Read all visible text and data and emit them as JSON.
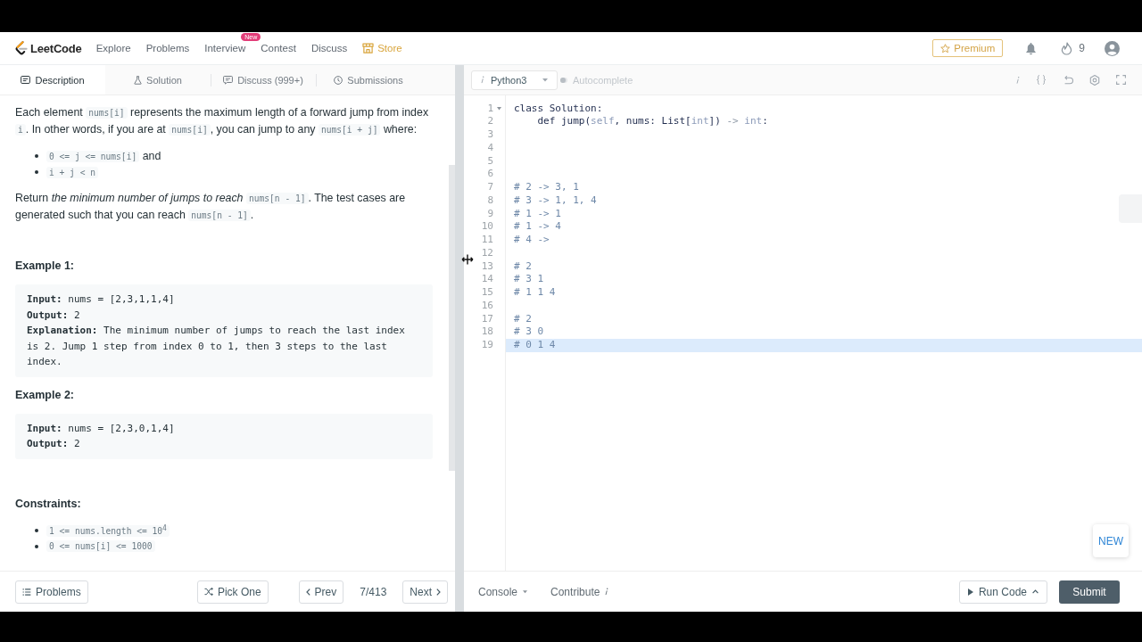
{
  "nav": {
    "logo": "LeetCode",
    "links": [
      {
        "label": "Explore",
        "kind": "link"
      },
      {
        "label": "Problems",
        "kind": "link"
      },
      {
        "label": "Interview",
        "kind": "link",
        "badge": "New"
      },
      {
        "label": "Contest",
        "kind": "link"
      },
      {
        "label": "Discuss",
        "kind": "link"
      },
      {
        "label": "Store",
        "kind": "store"
      }
    ],
    "premium": "Premium",
    "streak": "9"
  },
  "description_tabs": [
    {
      "label": "Description",
      "selected": true
    },
    {
      "label": "Solution",
      "selected": false
    },
    {
      "label": "Discuss (999+)",
      "selected": false
    },
    {
      "label": "Submissions",
      "selected": false
    }
  ],
  "description": {
    "intro": [
      {
        "kind": "paragraph",
        "segments": [
          {
            "kind": "text",
            "text": "Each element "
          },
          {
            "kind": "code",
            "text": "nums[i]"
          },
          {
            "kind": "text",
            "text": " represents the maximum length of a forward jump from index "
          },
          {
            "kind": "code",
            "text": "i"
          },
          {
            "kind": "text",
            "text": ". In other words, if you are at "
          },
          {
            "kind": "code",
            "text": "nums[i]"
          },
          {
            "kind": "text",
            "text": ", you can jump to any "
          },
          {
            "kind": "code",
            "text": "nums[i + j]"
          },
          {
            "kind": "text",
            "text": " where:"
          }
        ]
      },
      {
        "kind": "list",
        "items": [
          [
            {
              "kind": "code",
              "text": "0 <= j <= nums[i]"
            },
            {
              "kind": "text",
              "text": " and"
            }
          ],
          [
            {
              "kind": "code",
              "text": "i + j < n"
            }
          ]
        ]
      },
      {
        "kind": "paragraph",
        "segments": [
          {
            "kind": "text",
            "text": "Return *the minimum number of jumps to reach* "
          },
          {
            "kind": "code",
            "text": "nums[n - 1]"
          },
          {
            "kind": "text",
            "text": ". The test cases are generated such that you can reach "
          },
          {
            "kind": "code",
            "text": "nums[n - 1]"
          },
          {
            "kind": "text",
            "text": "."
          }
        ]
      }
    ],
    "examples": [
      {
        "title": "Example 1:",
        "lines": [
          "**Input:** nums = [2,3,1,1,4]",
          "**Output:** 2",
          "**Explanation:** The minimum number of jumps to reach the last index is 2. Jump 1 step from index 0 to 1, then 3 steps to the last index."
        ]
      },
      {
        "title": "Example 2:",
        "lines": [
          "**Input:** nums = [2,3,0,1,4]",
          "**Output:** 2"
        ]
      }
    ],
    "constraints": {
      "title": "Constraints:",
      "items": [
        "1 <= nums.length <= 10$^{4}$",
        "0 <= nums[i] <= 1000"
      ]
    }
  },
  "problem_nav": {
    "problems": "Problems",
    "pick_one": "Pick One",
    "prev": "Prev",
    "position": "7/413",
    "next": "Next"
  },
  "editor": {
    "language": "Python3",
    "autocomplete": {
      "label": "Autocomplete",
      "on": false
    },
    "lines": [
      {
        "number": "1",
        "foldable": true,
        "active": false,
        "tokens": [
          {
            "kind": "plain",
            "text": "class Solution:"
          }
        ]
      },
      {
        "number": "2",
        "foldable": false,
        "active": false,
        "tokens": [
          {
            "kind": "plain",
            "text": "    def jump("
          },
          {
            "kind": "builtin",
            "text": "self"
          },
          {
            "kind": "plain",
            "text": ", nums: List["
          },
          {
            "kind": "builtin",
            "text": "int"
          },
          {
            "kind": "plain",
            "text": "]) "
          },
          {
            "kind": "operator",
            "text": "-> "
          },
          {
            "kind": "builtin",
            "text": "int"
          },
          {
            "kind": "plain",
            "text": ":"
          }
        ]
      },
      {
        "number": "3",
        "foldable": false,
        "active": false
      },
      {
        "number": "4",
        "foldable": false,
        "active": false
      },
      {
        "number": "5",
        "foldable": false,
        "active": false
      },
      {
        "number": "6",
        "foldable": false,
        "active": false
      },
      {
        "number": "7",
        "foldable": false,
        "active": false,
        "tokens": [
          {
            "kind": "comment",
            "text": "# 2 -> 3, 1"
          }
        ]
      },
      {
        "number": "8",
        "foldable": false,
        "active": false,
        "tokens": [
          {
            "kind": "comment",
            "text": "# 3 -> 1, 1, 4"
          }
        ]
      },
      {
        "number": "9",
        "foldable": false,
        "active": false,
        "tokens": [
          {
            "kind": "comment",
            "text": "# 1 -> 1"
          }
        ]
      },
      {
        "number": "10",
        "foldable": false,
        "active": false,
        "tokens": [
          {
            "kind": "comment",
            "text": "# 1 -> 4"
          }
        ]
      },
      {
        "number": "11",
        "foldable": false,
        "active": false,
        "tokens": [
          {
            "kind": "comment",
            "text": "# 4 ->"
          }
        ]
      },
      {
        "number": "12",
        "foldable": false,
        "active": false
      },
      {
        "number": "13",
        "foldable": false,
        "active": false,
        "tokens": [
          {
            "kind": "comment",
            "text": "# 2"
          }
        ]
      },
      {
        "number": "14",
        "foldable": false,
        "active": false,
        "tokens": [
          {
            "kind": "comment",
            "text": "# 3 1"
          }
        ]
      },
      {
        "number": "15",
        "foldable": false,
        "active": false,
        "tokens": [
          {
            "kind": "comment",
            "text": "# 1 1 4"
          }
        ]
      },
      {
        "number": "16",
        "foldable": false,
        "active": false
      },
      {
        "number": "17",
        "foldable": false,
        "active": false,
        "tokens": [
          {
            "kind": "comment",
            "text": "# 2"
          }
        ]
      },
      {
        "number": "18",
        "foldable": false,
        "active": false,
        "tokens": [
          {
            "kind": "comment",
            "text": "# 3 0"
          }
        ]
      },
      {
        "number": "19",
        "foldable": false,
        "active": true,
        "tokens": [
          {
            "kind": "comment",
            "text": "# 0 1 4"
          }
        ]
      }
    ],
    "new_button": "NEW"
  },
  "editor_footer": {
    "console": "Console",
    "contribute": "Contribute",
    "run": "Run Code",
    "submit": "Submit"
  }
}
